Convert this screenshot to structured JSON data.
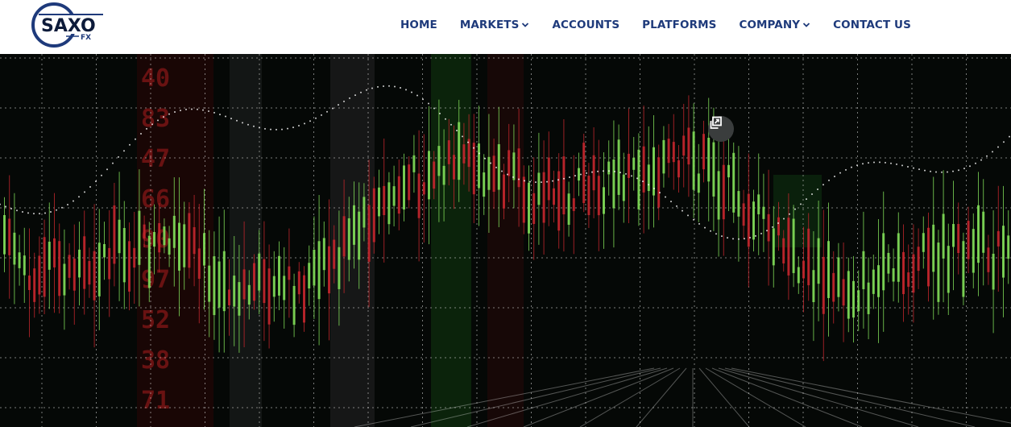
{
  "brand": {
    "name": "SAXO",
    "sub": "FX",
    "color": "#1e3a7b"
  },
  "nav": {
    "items": [
      {
        "label": "HOME",
        "dropdown": false
      },
      {
        "label": "MARKETS",
        "dropdown": true
      },
      {
        "label": "ACCOUNTS",
        "dropdown": false
      },
      {
        "label": "PLATFORMS",
        "dropdown": false
      },
      {
        "label": "COMPANY",
        "dropdown": true
      },
      {
        "label": "CONTACT US",
        "dropdown": false
      }
    ]
  },
  "hero": {
    "image": "candlestick-chart-background",
    "popout_icon": "popout-window-icon",
    "colors": {
      "up": "#7ed957",
      "down": "#c0262c",
      "grid": "#d9d9d9",
      "bg": "#050806"
    }
  }
}
